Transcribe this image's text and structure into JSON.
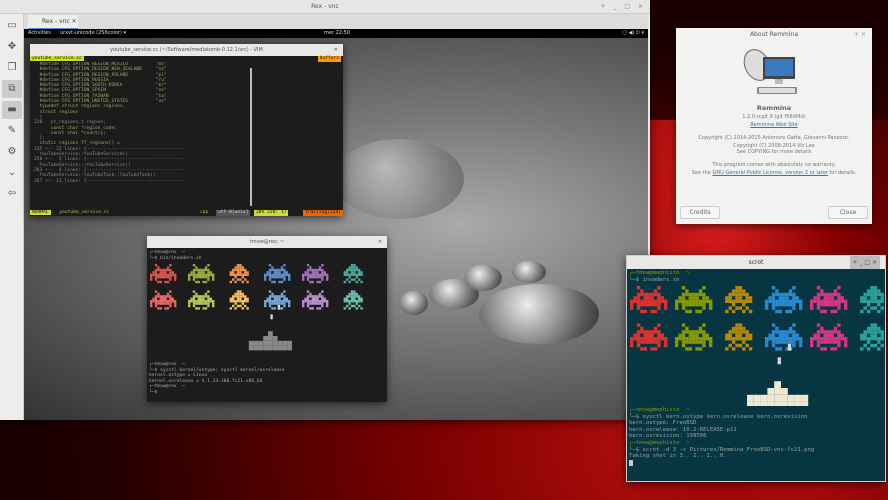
{
  "rex": {
    "title": "Rex - vnc",
    "tab": "Rex - vnc",
    "controls": "+ _ □ ✕"
  },
  "gnome": {
    "activities": "Activities",
    "app": "urxvt-unicode (256color) ▾",
    "clock": "mer 22:50",
    "tray": "▢ ◀) ⏻ ▾"
  },
  "vim": {
    "title": "youtube_service.cc (~/Software/mediatomb-0.12.1/src) - VIM",
    "tabfile": "youtube_service.cc",
    "buffers": "buffers",
    "lines": [
      "  #define CFG_OPTION_REGION_MEXICO          \"mx\"",
      "  #define CFG_OPTION_REGION_NEW_ZEALAND     \"nz\"",
      "  #define CFG_OPTION_REGION_POLAND          \"pl\"",
      "  #define CFG_OPTION_RUSSIA                 \"ru\"",
      "  #define CFG_OPTION_SOUTH_KOREA            \"kr\"",
      "  #define CFG_OPTION_SPAIN                  \"es\"",
      "  #define CFG_OPTION_TAIWAN                 \"tw\"",
      "  #define CFG_OPTION_UNITED_STATES          \"us\"",
      "",
      "  typedef struct regions regions;",
      "  struct regions",
      "  {",
      "228   yt_regions_t region;",
      "      const char *region_code;",
      "      const char *country;",
      "  };",
      "",
      "  static regions YT_regions[] =",
      "235 +-- 22 lines: {-----------------------------------",
      "",
      "  YouTubeService::YouTubeService()",
      "258 +--  5 lines: {-----------------------------------",
      "",
      "  YouTubeService::~YouTubeService()",
      "263 +--  4 lines: {-----------------------------------",
      "",
      "  YouTubeService::YouTubeTask::YouTubeTask()",
      "267 +-- 13 lines: {-----------------------------------"
    ],
    "status": {
      "mode": "NORMAL",
      "file": "youtube_service.cc",
      "ft": "cpp",
      "enc": "utf-8[unix]",
      "pos": "26%  228: 17",
      "warn": "trailing[224]"
    }
  },
  "term1": {
    "title": "tmow@rex: ~",
    "lines_top": [
      "┌─tmow@rex  ~",
      "└─$ bin/invaders.sh"
    ],
    "lines_bottom": [
      "┌─tmow@rex  ~",
      "└─$ sysctl kernel/ostype; sysctl kernel/osrelease",
      "kernel.ostype = Linux",
      "kernel.osrelease = 4.1.13-100.fc21.x86_64",
      "┌─tmow@rex  ~",
      "└─$"
    ],
    "colors": [
      "#d9534f",
      "#9aae3c",
      "#f0954a",
      "#5b8fc7",
      "#a272b6",
      "#4aa89a"
    ],
    "colors2": [
      "#e86868",
      "#b4c854",
      "#f8c060",
      "#78a8d8",
      "#b890d0",
      "#6ac0b0"
    ]
  },
  "about": {
    "title": "About Remmina",
    "name": "Remmina",
    "version": "1.2.0-rcgit.9 (git f56df4d)",
    "website": "Remmina Web Site",
    "copyright": [
      "Copyright (C) 2014-2015 Antenore Gatta, Giovanni Panozzo.",
      "Copyright (C) 2009-2014 Vic Lee",
      "See COPYING for more details"
    ],
    "warranty": "This program comes with absolutely no warranty.",
    "license_pre": "See the ",
    "license_link": "GNU General Public License, version 2 or later",
    "license_post": " for details.",
    "credits": "Credits",
    "close": "Close"
  },
  "scrot": {
    "title": "scrot",
    "prompt1": "┌─tmow@mephisto  ~",
    "cmd1": "└─$ invaders.sh",
    "lines": [
      "┌─tmow@mephisto  ~",
      "└─$ sysctl kern.ostype kern.osrelease kern.osrevision",
      "kern.ostype: FreeBSD",
      "kern.osrelease: 10.2-RELEASE-p11",
      "kern.osrevision: 199506",
      "┌─tmow@mephisto  ~",
      "└─$ scrot -d 3 -c Pictures/Remmina_FreeBSD-vnc-fc21.png",
      "Taking shot in 3.. 2.. 1.. 0."
    ],
    "colors": [
      "#dc322f",
      "#859900",
      "#b58900",
      "#268bd2",
      "#d33682",
      "#2aa198"
    ]
  }
}
